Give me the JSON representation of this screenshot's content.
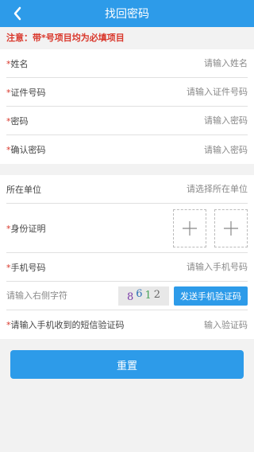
{
  "header": {
    "title": "找回密码",
    "back_icon": "chevron-left-icon"
  },
  "notice": "注意：带*号项目均为必填项目",
  "required_mark": "*",
  "personal": [
    {
      "label": "姓名",
      "placeholder": "请输入姓名"
    },
    {
      "label": "证件号码",
      "placeholder": "请输入证件号码"
    },
    {
      "label": "密码",
      "placeholder": "请输入密码"
    },
    {
      "label": "确认密码",
      "placeholder": "请输入密码"
    }
  ],
  "org": {
    "label": "所在单位",
    "placeholder": "请选择所在单位"
  },
  "id_proof": {
    "label": "身份证明",
    "upload_icon": "plus-icon"
  },
  "phone": {
    "label": "手机号码",
    "placeholder": "请输入手机号码"
  },
  "captcha": {
    "placeholder": "请输入右侧字符",
    "chars": [
      "8",
      "6",
      "1",
      "2"
    ],
    "send_label": "发送手机验证码"
  },
  "sms": {
    "label": "请输入手机收到的短信验证码",
    "placeholder": "输入验证码"
  },
  "reset_label": "重置",
  "colors": {
    "primary": "#2d9be9",
    "required": "#d9372b"
  }
}
